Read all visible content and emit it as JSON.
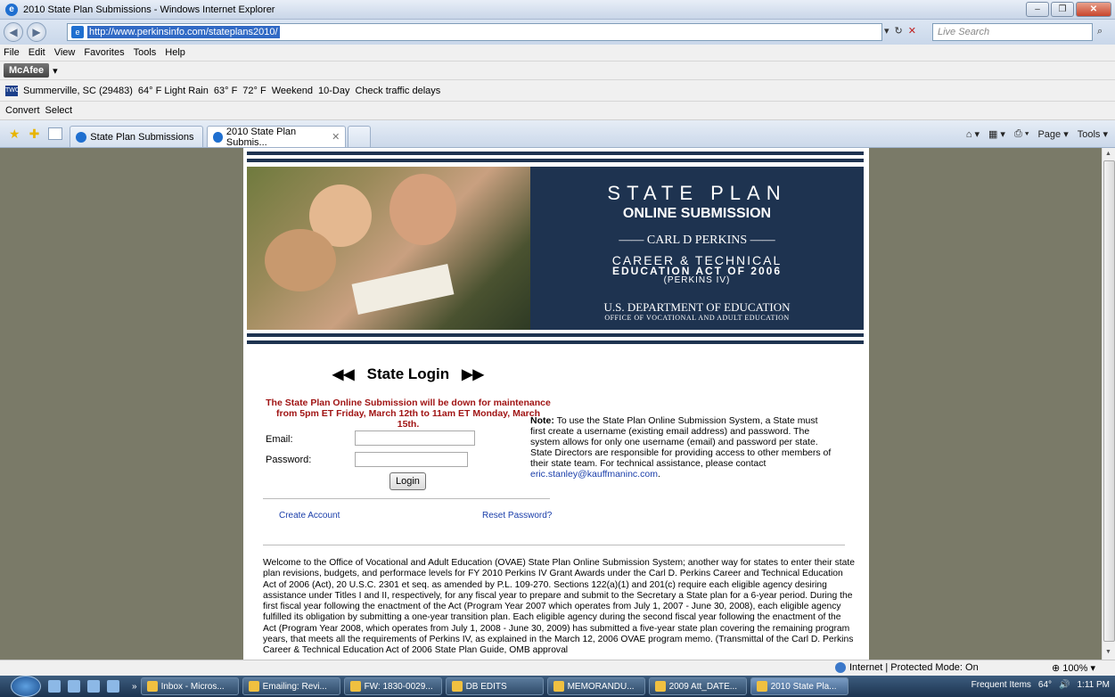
{
  "window": {
    "title": "2010 State Plan Submissions - Windows Internet Explorer",
    "buttons": [
      "–",
      "❐",
      "✕"
    ]
  },
  "address": {
    "url": "http://www.perkinsinfo.com/stateplans2010/",
    "search_placeholder": "Live Search"
  },
  "menu": [
    "File",
    "Edit",
    "View",
    "Favorites",
    "Tools",
    "Help"
  ],
  "mcafee": {
    "label": "McAfee"
  },
  "weather": {
    "location": "Summerville, SC (29483)",
    "now": "64° F Light Rain",
    "temp2": "63° F",
    "temp3": "72° F",
    "weekend": "Weekend",
    "ten_day": "10-Day",
    "traffic": "Check traffic delays"
  },
  "convert": {
    "convert": "Convert",
    "select": "Select"
  },
  "tabs": [
    {
      "label": "State Plan Submissions"
    },
    {
      "label": "2010 State Plan Submis..."
    }
  ],
  "cmd": {
    "page": "Page",
    "tools": "Tools"
  },
  "banner": {
    "line1": "STATE PLAN",
    "line2": "ONLINE SUBMISSION",
    "line3": "CARL D PERKINS",
    "line4": "CAREER & TECHNICAL",
    "line5": "EDUCATION ACT OF 2006",
    "line6": "(PERKINS IV)",
    "line7": "U.S. DEPARTMENT OF EDUCATION",
    "line8": "OFFICE OF VOCATIONAL AND ADULT EDUCATION"
  },
  "login": {
    "heading": "State Login",
    "maintenance": "The State Plan Online Submission will be down for maintenance from 5pm ET Friday, March 12th to 11am ET Monday, March 15th.",
    "email_label": "Email:",
    "password_label": "Password:",
    "button": "Login",
    "create_account": "Create Account",
    "reset_password": "Reset Password?"
  },
  "note": {
    "label": "Note:",
    "text": "To use the State Plan Online Submission System, a State must first create a username (existing email address) and password. The system allows for only one username (email) and password per state. State Directors are responsible for providing access to other members of their state team. For technical assistance, please contact",
    "email": "eric.stanley@kauffmaninc.com",
    "end": "."
  },
  "welcome": "Welcome to the Office of Vocational and Adult Education (OVAE) State Plan Online Submission System; another way for states to enter their state plan revisions, budgets, and performace levels for FY 2010 Perkins IV Grant Awards under the Carl D. Perkins Career and Technical Education Act of 2006 (Act), 20 U.S.C. 2301 et seq. as amended by P.L. 109-270. Sections 122(a)(1) and 201(c) require each eligible agency desiring assistance under Titles I and II, respectively, for any fiscal year to prepare and submit to the Secretary a State plan for a 6-year period. During the first fiscal year following the enactment of the Act (Program Year 2007 which operates from July 1, 2007 - June 30, 2008), each eligible agency fulfilled its obligation by submitting a one-year transition plan. Each eligible agency during the second fiscal year following the enactment of the Act (Program Year 2008, which operates from July 1, 2008 - June 30, 2009) has submitted a five-year state plan covering the remaining program years, that meets all the requirements of Perkins IV, as explained in the March 12, 2006 OVAE program memo. (Transmittal of the Carl D. Perkins Career & Technical Education Act of 2006 State Plan Guide, OMB approval",
  "status": {
    "zone": "Internet | Protected Mode: On",
    "zoom": "100%"
  },
  "taskbar": {
    "items": [
      "Inbox - Micros...",
      "Emailing: Revi...",
      "FW: 1830-0029...",
      "DB EDITS",
      "MEMORANDU...",
      "2009 Att_DATE...",
      "2010 State Pla..."
    ],
    "frequent": "Frequent Items",
    "temp": "64°",
    "time": "1:11 PM"
  }
}
